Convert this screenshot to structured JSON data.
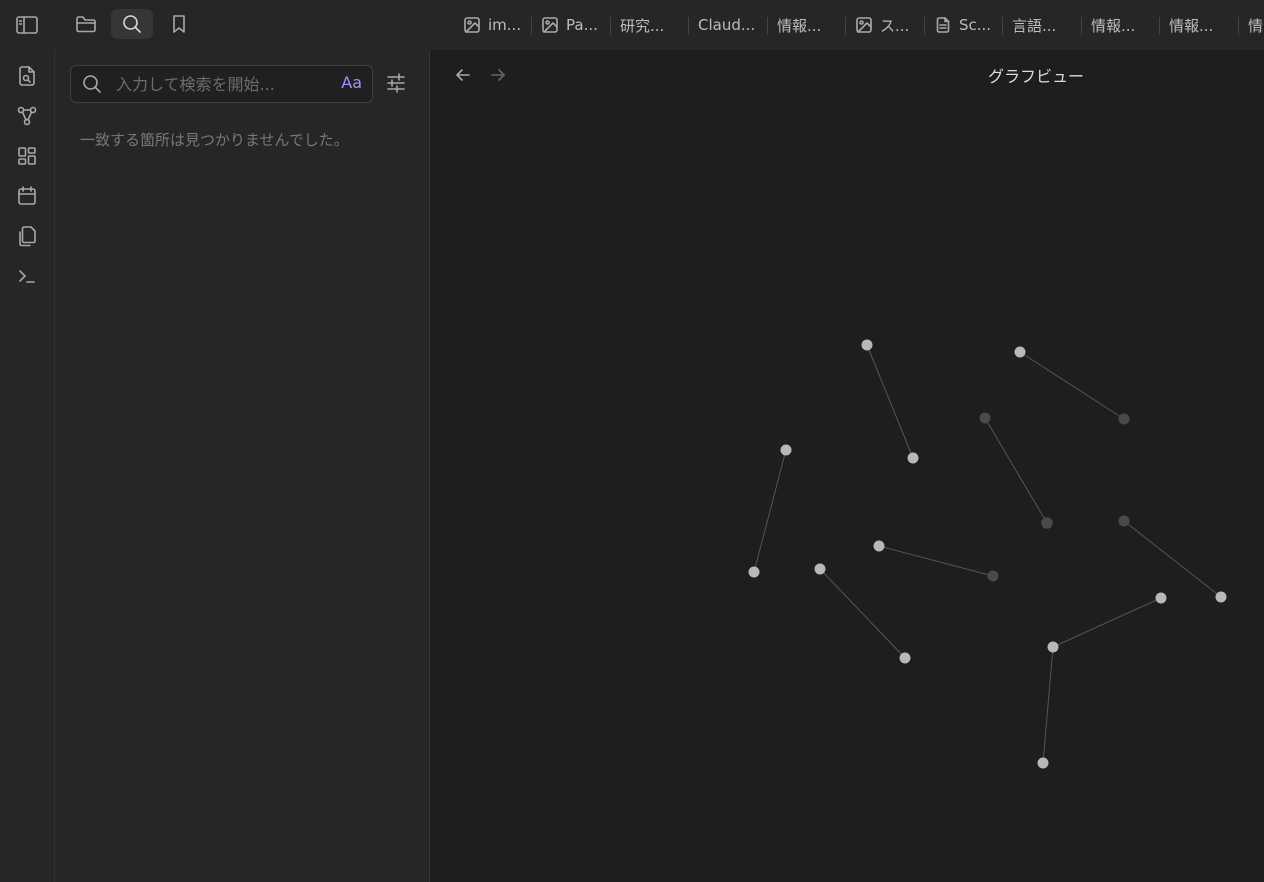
{
  "topbar": {
    "left_tabs": [
      {
        "name": "files",
        "icon": "folder-icon",
        "active": false
      },
      {
        "name": "search",
        "icon": "search-icon",
        "active": true
      },
      {
        "name": "bookmarks",
        "icon": "bookmark-icon",
        "active": false
      }
    ],
    "tabs": [
      {
        "label": "im...",
        "icon": "image-icon"
      },
      {
        "label": "Pa...",
        "icon": "image-icon"
      },
      {
        "label": "研究...",
        "icon": ""
      },
      {
        "label": "Claud...",
        "icon": ""
      },
      {
        "label": "情報...",
        "icon": ""
      },
      {
        "label": "ス...",
        "icon": "image-icon"
      },
      {
        "label": "Sc...",
        "icon": "document-icon"
      },
      {
        "label": "言語...",
        "icon": ""
      },
      {
        "label": "情報...",
        "icon": ""
      },
      {
        "label": "情報...",
        "icon": ""
      },
      {
        "label": "情",
        "icon": ""
      }
    ]
  },
  "ribbon": {
    "items": [
      "open-quick-switcher-icon",
      "graph-view-icon",
      "canvas-icon",
      "daily-note-calendar-icon",
      "templates-copy-icon",
      "command-palette-icon"
    ]
  },
  "search": {
    "placeholder": "入力して検索を開始...",
    "value": "",
    "match_case_label": "Aa",
    "no_results": "一致する箇所は見つかりませんでした。"
  },
  "main": {
    "title": "グラフビュー"
  },
  "graph": {
    "nodes": [
      {
        "id": "n1",
        "shade": "light"
      },
      {
        "id": "n2",
        "shade": "light"
      },
      {
        "id": "n3",
        "shade": "light"
      },
      {
        "id": "n4",
        "shade": "dark"
      },
      {
        "id": "n5",
        "shade": "light"
      },
      {
        "id": "n6",
        "shade": "light"
      },
      {
        "id": "n7",
        "shade": "dark"
      },
      {
        "id": "n8",
        "shade": "light"
      },
      {
        "id": "n9",
        "shade": "dark"
      },
      {
        "id": "n10",
        "shade": "light"
      },
      {
        "id": "n11",
        "shade": "light"
      },
      {
        "id": "n12",
        "shade": "light"
      },
      {
        "id": "n13",
        "shade": "dark"
      },
      {
        "id": "n14",
        "shade": "light"
      },
      {
        "id": "n15",
        "shade": "light"
      },
      {
        "id": "n16",
        "shade": "light"
      },
      {
        "id": "n17",
        "shade": "dark"
      },
      {
        "id": "n18",
        "shade": "light"
      }
    ],
    "edges": [
      [
        "n1",
        "n2"
      ],
      [
        "n3",
        "n4"
      ],
      [
        "n5",
        "n6"
      ],
      [
        "n7",
        "n8"
      ],
      [
        "n9",
        "n10"
      ],
      [
        "n11",
        "n12"
      ],
      [
        "n14",
        "n13"
      ],
      [
        "n15",
        "n16"
      ],
      [
        "n16",
        "n18"
      ],
      [
        "n8",
        "n17"
      ]
    ],
    "colors": {
      "node_light": "#b8b8b8",
      "node_dark": "#4a4a4a",
      "edge": "#555555"
    }
  }
}
